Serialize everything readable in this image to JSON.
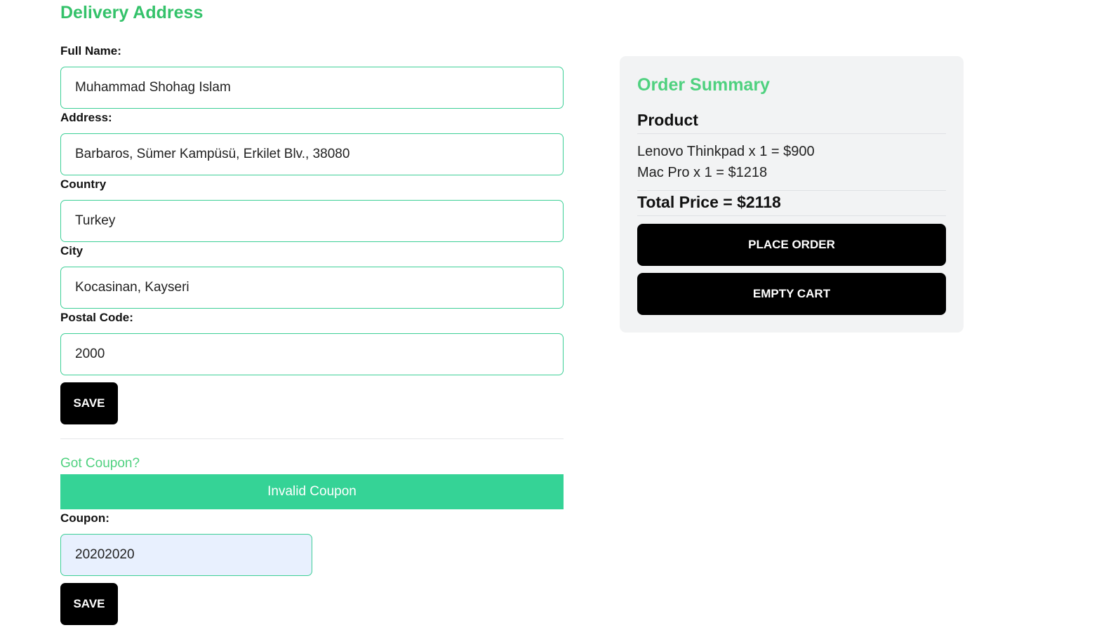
{
  "delivery": {
    "title": "Delivery Address",
    "fields": [
      {
        "label": "Full Name:",
        "value": "Muhammad Shohag Islam"
      },
      {
        "label": "Address:",
        "value": "Barbaros, Sümer Kampüsü, Erkilet Blv., 38080"
      },
      {
        "label": "Country",
        "value": "Turkey"
      },
      {
        "label": "City",
        "value": "Kocasinan, Kayseri"
      },
      {
        "label": "Postal Code:",
        "value": "2000"
      }
    ],
    "save_label": "SAVE"
  },
  "coupon": {
    "heading": "Got Coupon?",
    "alert": "Invalid Coupon",
    "label": "Coupon:",
    "value": "20202020",
    "save_label": "SAVE"
  },
  "summary": {
    "title": "Order Summary",
    "product_heading": "Product",
    "items": [
      "Lenovo Thinkpad x 1 = $900",
      "Mac Pro x 1 = $1218"
    ],
    "total": "Total Price = $2118",
    "place_order_label": "PLACE ORDER",
    "empty_cart_label": "EMPTY CART"
  },
  "colors": {
    "accent_green": "#34c26a",
    "input_border": "#3ccf96",
    "alert_background": "#35d396",
    "panel_background": "#f2f3f4",
    "button_background": "#000000"
  }
}
